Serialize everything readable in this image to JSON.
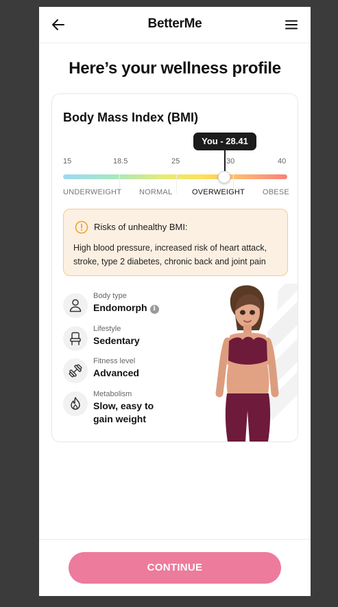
{
  "header": {
    "logo": "BetterMe"
  },
  "page_title": "Here’s your wellness profile",
  "bmi_card": {
    "title": "Body Mass Index (BMI)",
    "tooltip": "You - 28.41",
    "value": 28.41,
    "scale_ticks": [
      "15",
      "18.5",
      "25",
      "30",
      "40"
    ],
    "categories": [
      "UNDERWEIGHT",
      "NORMAL",
      "OVERWEIGHT",
      "OBESE"
    ],
    "active_category": "OVERWEIGHT"
  },
  "warning": {
    "title": "Risks of unhealthy BMI:",
    "text": "High blood pressure, increased risk of heart attack, stroke, type 2 diabetes, chronic back and joint pain",
    "accent_color": "#f0a030"
  },
  "stats": [
    {
      "label": "Body type",
      "value": "Endomorph",
      "icon": "person-icon"
    },
    {
      "label": "Lifestyle",
      "value": "Sedentary",
      "icon": "chair-icon"
    },
    {
      "label": "Fitness level",
      "value": "Advanced",
      "icon": "dumbbell-icon"
    },
    {
      "label": "Metabolism",
      "value": "Slow, easy to gain weight",
      "icon": "flame-icon"
    }
  ],
  "cta": {
    "label": "CONTINUE",
    "color": "#ec7b9c"
  }
}
